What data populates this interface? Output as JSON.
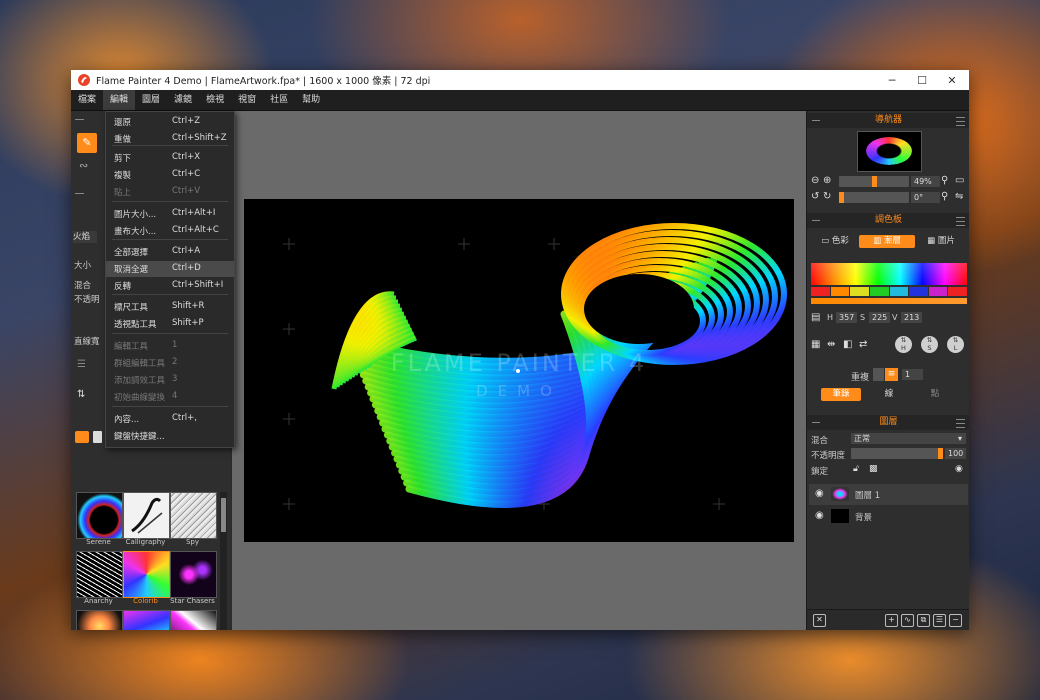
{
  "window": {
    "title": "Flame Painter 4 Demo | FlameArtwork.fpa* | 1600 x 1000 像素 | 72 dpi"
  },
  "menubar": [
    "檔案",
    "編輯",
    "圖層",
    "濾鏡",
    "檢視",
    "視窗",
    "社區",
    "幫助"
  ],
  "left_panel": {
    "label_fire": "火焰",
    "label_size": "大小",
    "label_blend": "混合",
    "label_opacity": "不透明",
    "label_straight": "直線寬"
  },
  "edit_menu": [
    {
      "label": "還原",
      "shortcut": "Ctrl+Z",
      "disabled": false
    },
    {
      "label": "重做",
      "shortcut": "Ctrl+Shift+Z",
      "disabled": false
    },
    {
      "label": "剪下",
      "shortcut": "Ctrl+X",
      "disabled": false
    },
    {
      "label": "複製",
      "shortcut": "Ctrl+C",
      "disabled": false
    },
    {
      "label": "貼上",
      "shortcut": "Ctrl+V",
      "disabled": true
    },
    {
      "label": "圖片大小...",
      "shortcut": "Ctrl+Alt+I",
      "disabled": false
    },
    {
      "label": "畫布大小...",
      "shortcut": "Ctrl+Alt+C",
      "disabled": false
    },
    {
      "label": "全部選擇",
      "shortcut": "Ctrl+A",
      "disabled": false
    },
    {
      "label": "取消全選",
      "shortcut": "Ctrl+D",
      "disabled": false
    },
    {
      "label": "反轉",
      "shortcut": "Ctrl+Shift+I",
      "disabled": false
    },
    {
      "label": "標尺工具",
      "shortcut": "Shift+R",
      "disabled": false
    },
    {
      "label": "透視點工具",
      "shortcut": "Shift+P",
      "disabled": false
    },
    {
      "label": "編輯工具",
      "shortcut": "1",
      "disabled": true
    },
    {
      "label": "群組編輯工具",
      "shortcut": "2",
      "disabled": true
    },
    {
      "label": "添加調效工具",
      "shortcut": "3",
      "disabled": true
    },
    {
      "label": "初始曲線變換",
      "shortcut": "4",
      "disabled": true
    },
    {
      "label": "內容...",
      "shortcut": "Ctrl+,",
      "disabled": false
    },
    {
      "label": "鍵盤快捷鍵...",
      "shortcut": "",
      "disabled": false
    }
  ],
  "brushes": [
    "Serene",
    "Calligraphy",
    "Spy",
    "Anarchy",
    "Colorib",
    "Star Chasers"
  ],
  "canvas": {
    "watermark_title": "FLAME PAINTER 4",
    "watermark_sub": "DEMO"
  },
  "navigator": {
    "title": "導航器",
    "zoom": "49%",
    "rotation": "0°"
  },
  "palette": {
    "title": "調色板",
    "tabs": [
      "色彩",
      "漸層",
      "圖片"
    ],
    "h_label": "H",
    "h": "357",
    "s_label": "S",
    "s": "225",
    "v_label": "V",
    "v": "213",
    "circle_h": "H",
    "circle_s": "S",
    "circle_l": "L",
    "repeat_label": "重複",
    "repeat_value": "1",
    "mode_tabs": [
      "筆錄",
      "線",
      "點"
    ]
  },
  "layers": {
    "title": "圖層",
    "blend_label": "混合",
    "blend_value": "正常",
    "opacity_label": "不透明度",
    "opacity_value": "100",
    "lock_label": "鎖定",
    "items": [
      "圖層 1",
      "背景"
    ]
  },
  "colors": {
    "accent": "#ff8c1a"
  }
}
